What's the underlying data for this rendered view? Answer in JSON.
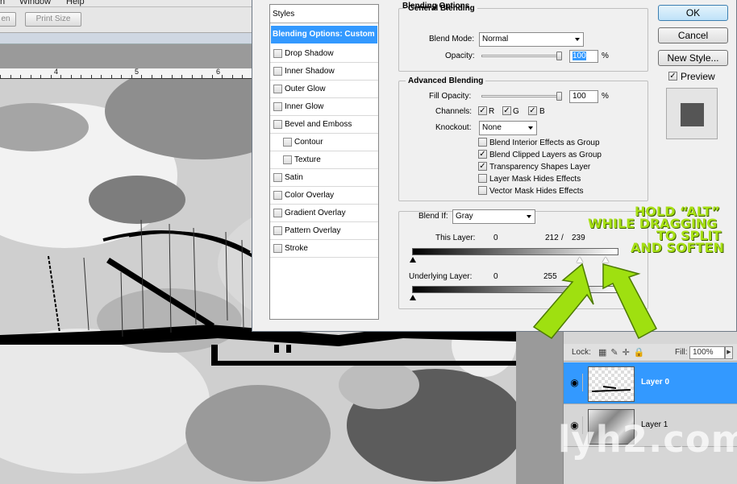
{
  "app": {
    "menu": [
      "n",
      "Window",
      "Help"
    ],
    "options_bar": {
      "btn_left": "en",
      "print_size": "Print Size"
    }
  },
  "ruler": {
    "labels": [
      "4",
      "5",
      "6"
    ]
  },
  "dialog": {
    "styles_header": "Styles",
    "styles_selected": "Blending Options: Custom",
    "styles": [
      {
        "label": "Drop Shadow",
        "checked": false,
        "indent": false
      },
      {
        "label": "Inner Shadow",
        "checked": false,
        "indent": false
      },
      {
        "label": "Outer Glow",
        "checked": false,
        "indent": false
      },
      {
        "label": "Inner Glow",
        "checked": false,
        "indent": false
      },
      {
        "label": "Bevel and Emboss",
        "checked": false,
        "indent": false
      },
      {
        "label": "Contour",
        "checked": false,
        "indent": true
      },
      {
        "label": "Texture",
        "checked": false,
        "indent": true
      },
      {
        "label": "Satin",
        "checked": false,
        "indent": false
      },
      {
        "label": "Color Overlay",
        "checked": false,
        "indent": false
      },
      {
        "label": "Gradient Overlay",
        "checked": false,
        "indent": false
      },
      {
        "label": "Pattern Overlay",
        "checked": false,
        "indent": false
      },
      {
        "label": "Stroke",
        "checked": false,
        "indent": false
      }
    ],
    "blending_title": "Blending Options",
    "general": {
      "title": "General Blending",
      "blend_mode_label": "Blend Mode:",
      "blend_mode": "Normal",
      "opacity_label": "Opacity:",
      "opacity": "100",
      "opacity_unit": "%"
    },
    "advanced": {
      "title": "Advanced Blending",
      "fill_label": "Fill Opacity:",
      "fill": "100",
      "fill_unit": "%",
      "channels_label": "Channels:",
      "channels": [
        {
          "label": "R",
          "checked": true
        },
        {
          "label": "G",
          "checked": true
        },
        {
          "label": "B",
          "checked": true
        }
      ],
      "knockout_label": "Knockout:",
      "knockout": "None",
      "options": [
        {
          "label": "Blend Interior Effects as Group",
          "checked": false
        },
        {
          "label": "Blend Clipped Layers as Group",
          "checked": true
        },
        {
          "label": "Transparency Shapes Layer",
          "checked": true
        },
        {
          "label": "Layer Mask Hides Effects",
          "checked": false
        },
        {
          "label": "Vector Mask Hides Effects",
          "checked": false
        }
      ]
    },
    "blend_if": {
      "label": "Blend If:",
      "value": "Gray",
      "this_layer_label": "This Layer:",
      "this_layer_low": "0",
      "this_layer_high_a": "212",
      "this_layer_sep": "/",
      "this_layer_high_b": "239",
      "underlying_label": "Underlying Layer:",
      "underlying_low": "0",
      "underlying_high": "255"
    },
    "buttons": {
      "ok": "OK",
      "cancel": "Cancel",
      "new_style": "New Style...",
      "preview": "Preview"
    },
    "preview_checked": true
  },
  "layers_panel": {
    "lock_label": "Lock:",
    "fill_label": "Fill:",
    "fill_value": "100%",
    "layers": [
      {
        "name": "Layer 0",
        "selected": true
      },
      {
        "name": "Layer 1",
        "selected": false
      }
    ]
  },
  "annotation": {
    "lines": [
      "HOLD “ALT”",
      "WHILE DRAGGING",
      "TO SPLIT",
      "AND SOFTEN"
    ]
  },
  "watermark": "lyh2.com",
  "colors": {
    "selection": "#3399ff",
    "annotation": "#a7e014",
    "arrow": "#9fe010"
  }
}
